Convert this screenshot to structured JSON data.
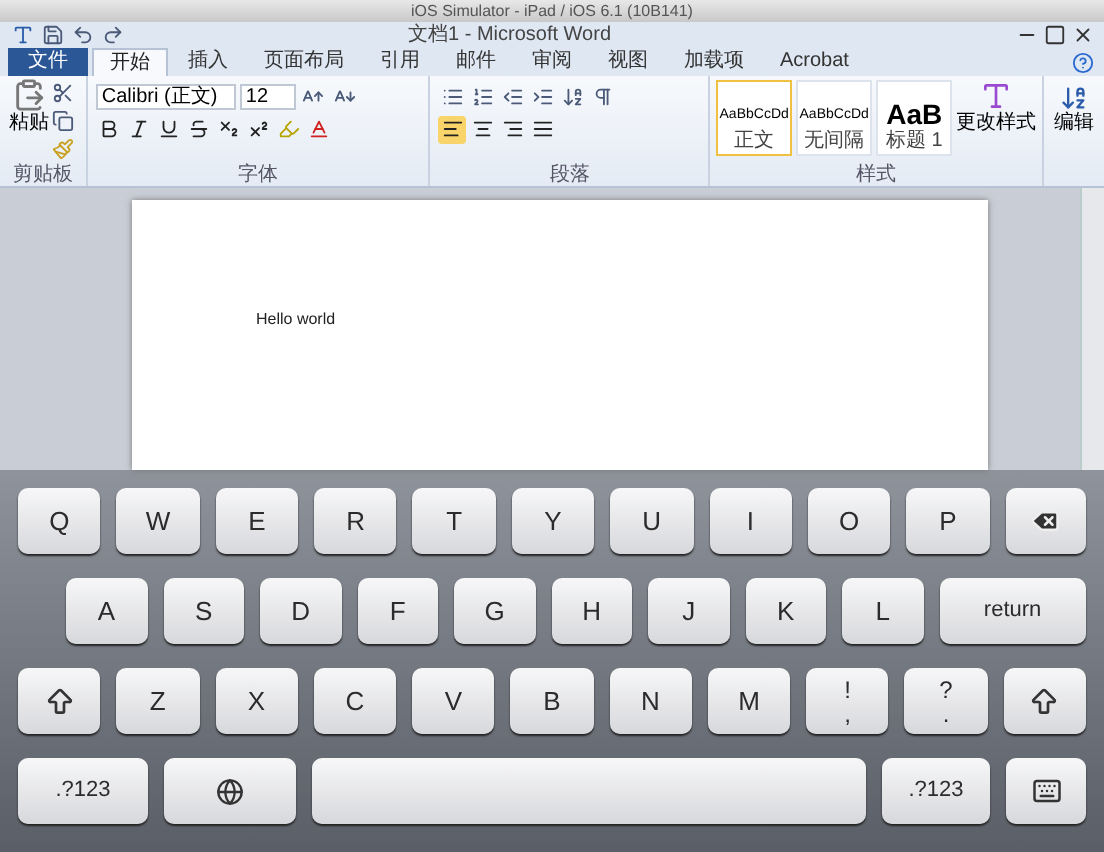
{
  "simulator_title": "iOS Simulator - iPad / iOS 6.1 (10B141)",
  "window": {
    "title": "文档1 - Microsoft Word"
  },
  "ribbon_tabs": [
    {
      "label": "文件",
      "kind": "file",
      "selected": false
    },
    {
      "label": "开始",
      "kind": "tab",
      "selected": true
    },
    {
      "label": "插入",
      "kind": "tab",
      "selected": false
    },
    {
      "label": "页面布局",
      "kind": "tab",
      "selected": false
    },
    {
      "label": "引用",
      "kind": "tab",
      "selected": false
    },
    {
      "label": "邮件",
      "kind": "tab",
      "selected": false
    },
    {
      "label": "审阅",
      "kind": "tab",
      "selected": false
    },
    {
      "label": "视图",
      "kind": "tab",
      "selected": false
    },
    {
      "label": "加载项",
      "kind": "tab",
      "selected": false
    },
    {
      "label": "Acrobat",
      "kind": "tab",
      "selected": false
    }
  ],
  "ribbon": {
    "paste_label": "粘贴",
    "font_name": "Calibri (正文)",
    "font_size": "12",
    "styles": [
      {
        "sample": "AaBbCcDd",
        "label": "正文",
        "kind": "small",
        "selected": true
      },
      {
        "sample": "AaBbCcDd",
        "label": "无间隔",
        "kind": "small",
        "selected": false
      },
      {
        "sample": "AaB",
        "label": "标题 1",
        "kind": "large",
        "selected": false
      }
    ],
    "change_styles": "更改样式",
    "editing": "编辑",
    "groups": [
      "剪贴板",
      "字体",
      "段落",
      "样式"
    ]
  },
  "document": {
    "text": "Hello world"
  },
  "keyboard": {
    "rows": [
      {
        "keys": [
          {
            "kind": "letter",
            "label": "Q"
          },
          {
            "kind": "letter",
            "label": "W"
          },
          {
            "kind": "letter",
            "label": "E"
          },
          {
            "kind": "letter",
            "label": "R"
          },
          {
            "kind": "letter",
            "label": "T"
          },
          {
            "kind": "letter",
            "label": "Y"
          },
          {
            "kind": "letter",
            "label": "U"
          },
          {
            "kind": "letter",
            "label": "I"
          },
          {
            "kind": "letter",
            "label": "O"
          },
          {
            "kind": "letter",
            "label": "P"
          },
          {
            "kind": "backspace"
          }
        ]
      },
      {
        "keys": [
          {
            "kind": "letter",
            "label": "A"
          },
          {
            "kind": "letter",
            "label": "S"
          },
          {
            "kind": "letter",
            "label": "D"
          },
          {
            "kind": "letter",
            "label": "F"
          },
          {
            "kind": "letter",
            "label": "G"
          },
          {
            "kind": "letter",
            "label": "H"
          },
          {
            "kind": "letter",
            "label": "J"
          },
          {
            "kind": "letter",
            "label": "K"
          },
          {
            "kind": "letter",
            "label": "L"
          },
          {
            "kind": "return",
            "label": "return"
          }
        ]
      },
      {
        "keys": [
          {
            "kind": "shift"
          },
          {
            "kind": "letter",
            "label": "Z"
          },
          {
            "kind": "letter",
            "label": "X"
          },
          {
            "kind": "letter",
            "label": "C"
          },
          {
            "kind": "letter",
            "label": "V"
          },
          {
            "kind": "letter",
            "label": "B"
          },
          {
            "kind": "letter",
            "label": "N"
          },
          {
            "kind": "letter",
            "label": "M"
          },
          {
            "kind": "dual",
            "top": "!",
            "label": ","
          },
          {
            "kind": "dual",
            "top": "?",
            "label": "."
          },
          {
            "kind": "shift"
          }
        ]
      },
      {
        "keys": [
          {
            "kind": "mode",
            "label": ".?123"
          },
          {
            "kind": "globe"
          },
          {
            "kind": "space"
          },
          {
            "kind": "mode",
            "label": ".?123"
          },
          {
            "kind": "hide"
          }
        ]
      }
    ]
  }
}
